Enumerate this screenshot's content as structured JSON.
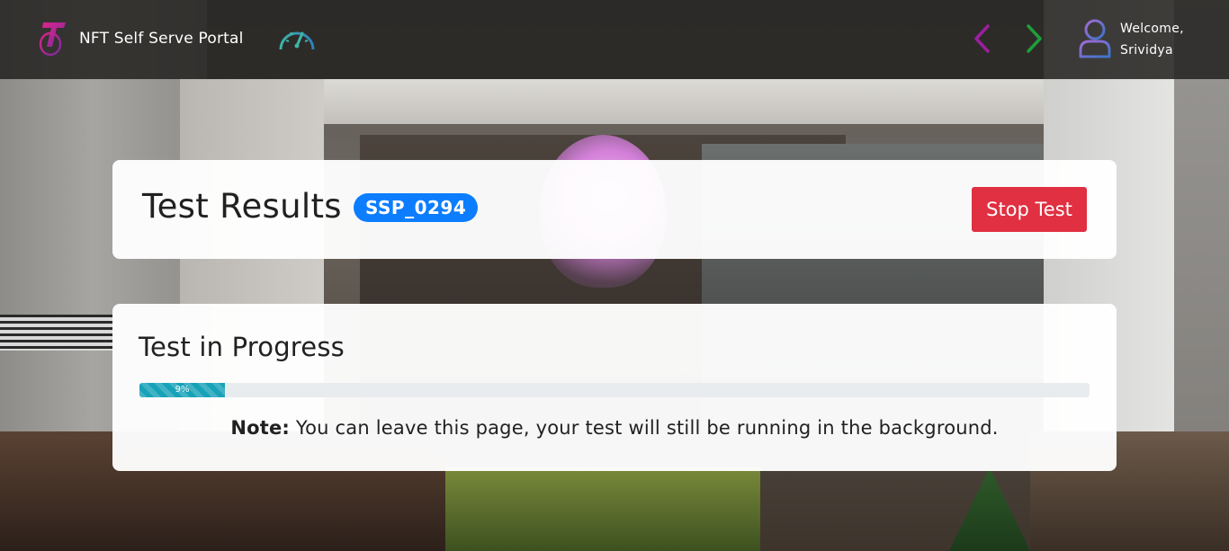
{
  "navbar": {
    "brand": "NFT Self Serve Portal",
    "logo_icon": "telstra-t-logo-icon",
    "dashboard_icon": "speedometer-icon",
    "prev_icon": "chevron-left-icon",
    "next_icon": "chevron-right-icon",
    "user_icon": "user-icon",
    "welcome_label": "Welcome,",
    "user_name": "Srividya",
    "colors": {
      "prev": "#9b1fa0",
      "next": "#1e9e3a",
      "brand_accent": "#a3248f"
    }
  },
  "results": {
    "title": "Test Results",
    "test_id": "SSP_0294",
    "stop_label": "Stop Test",
    "colors": {
      "badge": "#0d7dff",
      "stop": "#e03041"
    }
  },
  "progress": {
    "title": "Test in Progress",
    "percent": 9,
    "percent_label": "9%",
    "note_label": "Note:",
    "note_text": " You can leave this page, your test will still be running in the background.",
    "colors": {
      "bar": "#17a2b8",
      "track": "#e9ecef"
    }
  }
}
